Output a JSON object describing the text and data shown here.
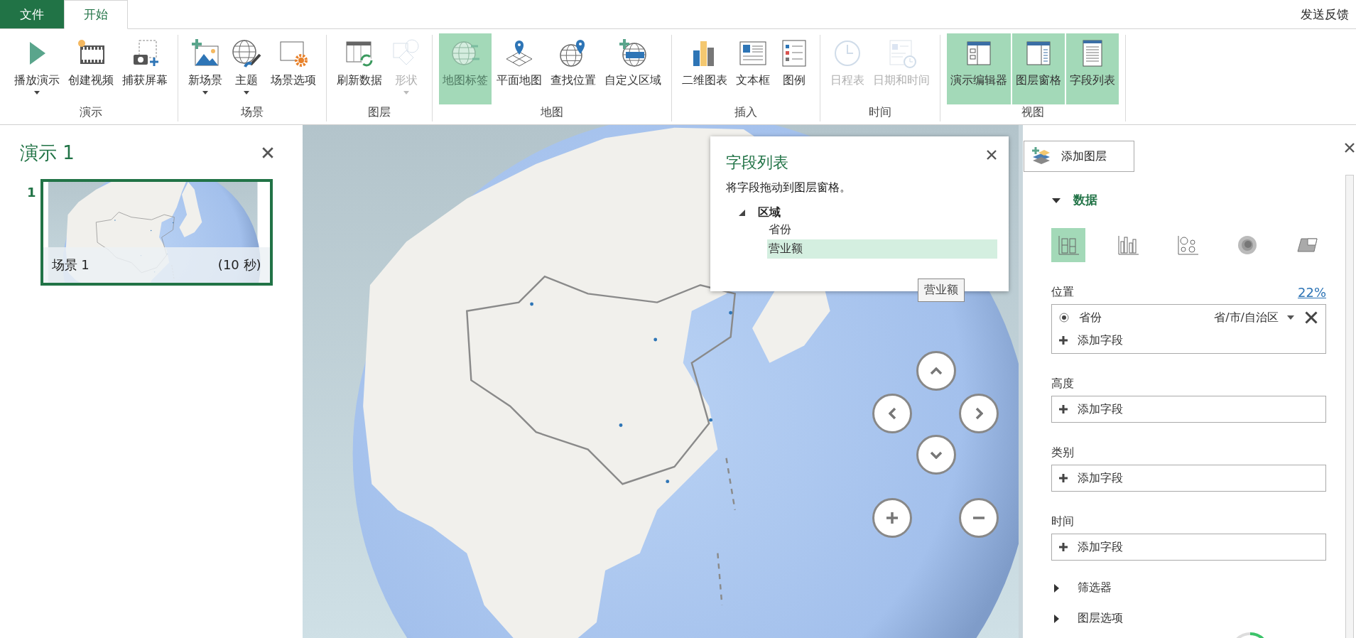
{
  "tabs": [
    {
      "label": "文件",
      "kind": "file",
      "selected": false
    },
    {
      "label": "开始",
      "kind": "tab",
      "selected": true
    }
  ],
  "feedback_link": "发送反馈",
  "ribbon": {
    "groups": [
      {
        "label": "演示",
        "buttons": [
          {
            "label": "播放演示",
            "kind": "play",
            "dropdown": true,
            "disabled": false,
            "selected": false
          },
          {
            "label": "创建视频",
            "kind": "video",
            "dropdown": false,
            "disabled": false,
            "selected": false
          },
          {
            "label": "捕获屏幕",
            "kind": "capture",
            "dropdown": false,
            "disabled": false,
            "selected": false
          }
        ]
      },
      {
        "label": "场景",
        "buttons": [
          {
            "label": "新场景",
            "kind": "new-scene",
            "dropdown": true,
            "disabled": false,
            "selected": false
          },
          {
            "label": "主题",
            "kind": "theme",
            "dropdown": true,
            "disabled": false,
            "selected": false
          },
          {
            "label": "场景选项",
            "kind": "scene-options",
            "dropdown": false,
            "disabled": false,
            "selected": false
          }
        ]
      },
      {
        "label": "图层",
        "buttons": [
          {
            "label": "刷新数据",
            "kind": "refresh",
            "dropdown": false,
            "disabled": false,
            "selected": false
          },
          {
            "label": "形状",
            "kind": "shapes",
            "dropdown": true,
            "disabled": true,
            "selected": false
          }
        ]
      },
      {
        "label": "地图",
        "buttons": [
          {
            "label": "地图标签",
            "kind": "map-labels",
            "dropdown": false,
            "disabled": true,
            "selected": true
          },
          {
            "label": "平面地图",
            "kind": "flat-map",
            "dropdown": false,
            "disabled": false,
            "selected": false
          },
          {
            "label": "查找位置",
            "kind": "find-location",
            "dropdown": false,
            "disabled": false,
            "selected": false
          },
          {
            "label": "自定义区域",
            "kind": "custom-regions",
            "dropdown": false,
            "disabled": false,
            "selected": false
          }
        ]
      },
      {
        "label": "插入",
        "buttons": [
          {
            "label": "二维图表",
            "kind": "chart",
            "dropdown": false,
            "disabled": false,
            "selected": false
          },
          {
            "label": "文本框",
            "kind": "text-box",
            "dropdown": false,
            "disabled": false,
            "selected": false
          },
          {
            "label": "图例",
            "kind": "legend",
            "dropdown": false,
            "disabled": false,
            "selected": false
          }
        ]
      },
      {
        "label": "时间",
        "buttons": [
          {
            "label": "日程表",
            "kind": "timeline",
            "dropdown": false,
            "disabled": true,
            "selected": false
          },
          {
            "label": "日期和时间",
            "kind": "date-time",
            "dropdown": false,
            "disabled": true,
            "selected": false
          }
        ]
      },
      {
        "label": "视图",
        "buttons": [
          {
            "label": "演示编辑器",
            "kind": "tour-editor",
            "dropdown": false,
            "disabled": false,
            "selected": true
          },
          {
            "label": "图层窗格",
            "kind": "layer-pane",
            "dropdown": false,
            "disabled": false,
            "selected": true
          },
          {
            "label": "字段列表",
            "kind": "field-list",
            "dropdown": false,
            "disabled": false,
            "selected": true
          }
        ]
      }
    ]
  },
  "tour_panel": {
    "title": "演示 1",
    "scenes": [
      {
        "number": "1",
        "name": "场景 1",
        "duration": "(10 秒)",
        "selected": true
      }
    ]
  },
  "field_list": {
    "title": "字段列表",
    "hint": "将字段拖动到图层窗格。",
    "tables": [
      {
        "name": "区域",
        "expanded": true,
        "children": [
          {
            "name": "省份",
            "selected": false
          },
          {
            "name": "营业额",
            "selected": true
          }
        ]
      }
    ],
    "tooltip": "营业额"
  },
  "layer_pane": {
    "add_layer": "添加图层",
    "data_section": {
      "label": "数据",
      "expanded": true
    },
    "chart_types": [
      {
        "kind": "stacked-column",
        "selected": true
      },
      {
        "kind": "clustered-column",
        "selected": false
      },
      {
        "kind": "bubble",
        "selected": false
      },
      {
        "kind": "heat-map",
        "selected": false
      },
      {
        "kind": "region",
        "selected": false
      }
    ],
    "wells": [
      {
        "label": "位置",
        "link": "22%",
        "fields": [
          {
            "kind": "field",
            "name": "省份",
            "checked": true,
            "type": "省/市/自治区"
          },
          {
            "kind": "add",
            "name": "添加字段"
          }
        ]
      },
      {
        "label": "高度",
        "fields": [
          {
            "kind": "add",
            "name": "添加字段"
          }
        ]
      },
      {
        "label": "类别",
        "fields": [
          {
            "kind": "add",
            "name": "添加字段"
          }
        ]
      },
      {
        "label": "时间",
        "fields": [
          {
            "kind": "add",
            "name": "添加字段"
          }
        ]
      }
    ],
    "sections": [
      {
        "label": "筛选器",
        "expanded": false
      },
      {
        "label": "图层选项",
        "expanded": false
      }
    ]
  }
}
